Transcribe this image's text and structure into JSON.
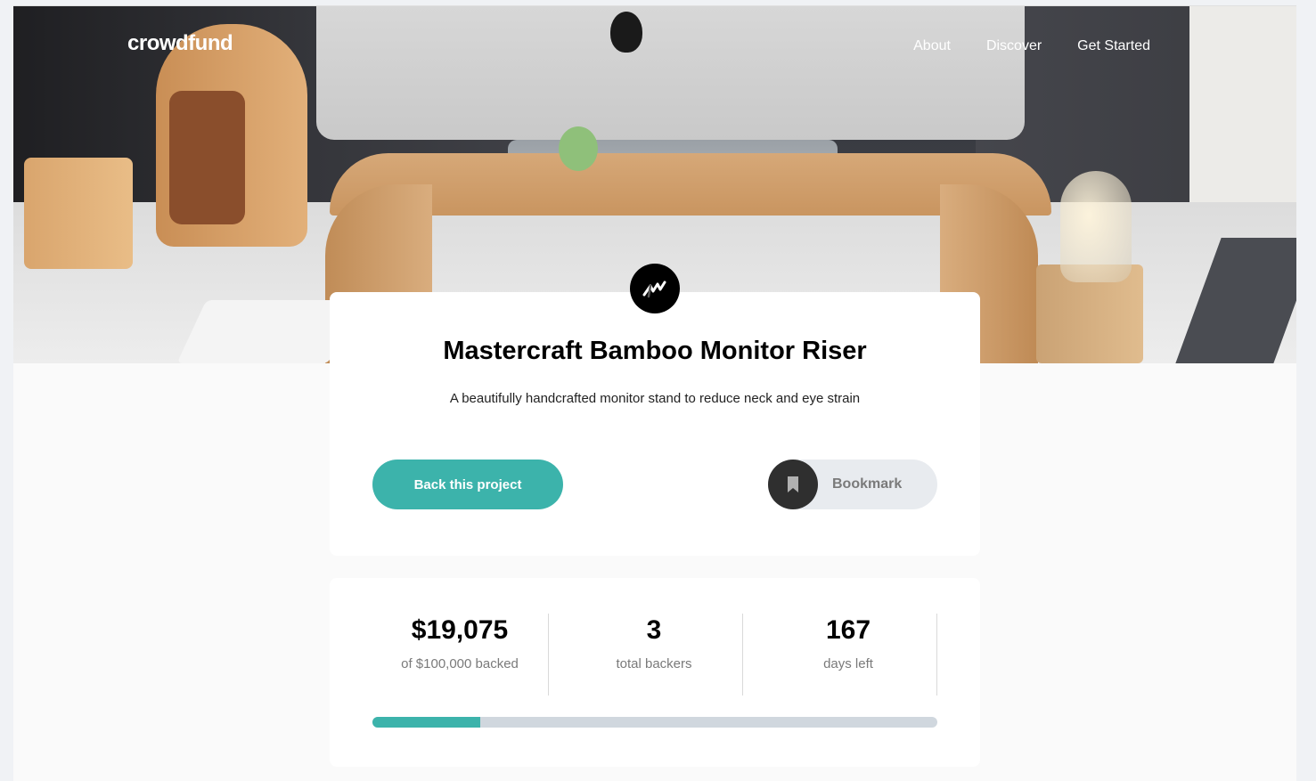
{
  "header": {
    "logo": "crowdfund",
    "nav": [
      {
        "label": "About"
      },
      {
        "label": "Discover"
      },
      {
        "label": "Get Started"
      }
    ]
  },
  "project": {
    "title": "Mastercraft Bamboo Monitor Riser",
    "description": "A beautifully handcrafted monitor stand to reduce neck and eye strain",
    "back_button": "Back this project",
    "bookmark_button": "Bookmark"
  },
  "stats": {
    "backed_amount": "$19,075",
    "backed_label": "of $100,000 backed",
    "backers_count": "3",
    "backers_label": "total backers",
    "days_count": "167",
    "days_label": "days left",
    "progress_fraction": 0.19075
  },
  "colors": {
    "accent": "#3cb3ab",
    "dark": "#2f2f2f"
  },
  "icons": {
    "brand_mark": "mastercraft-logo-icon",
    "bookmark": "bookmark-icon"
  }
}
